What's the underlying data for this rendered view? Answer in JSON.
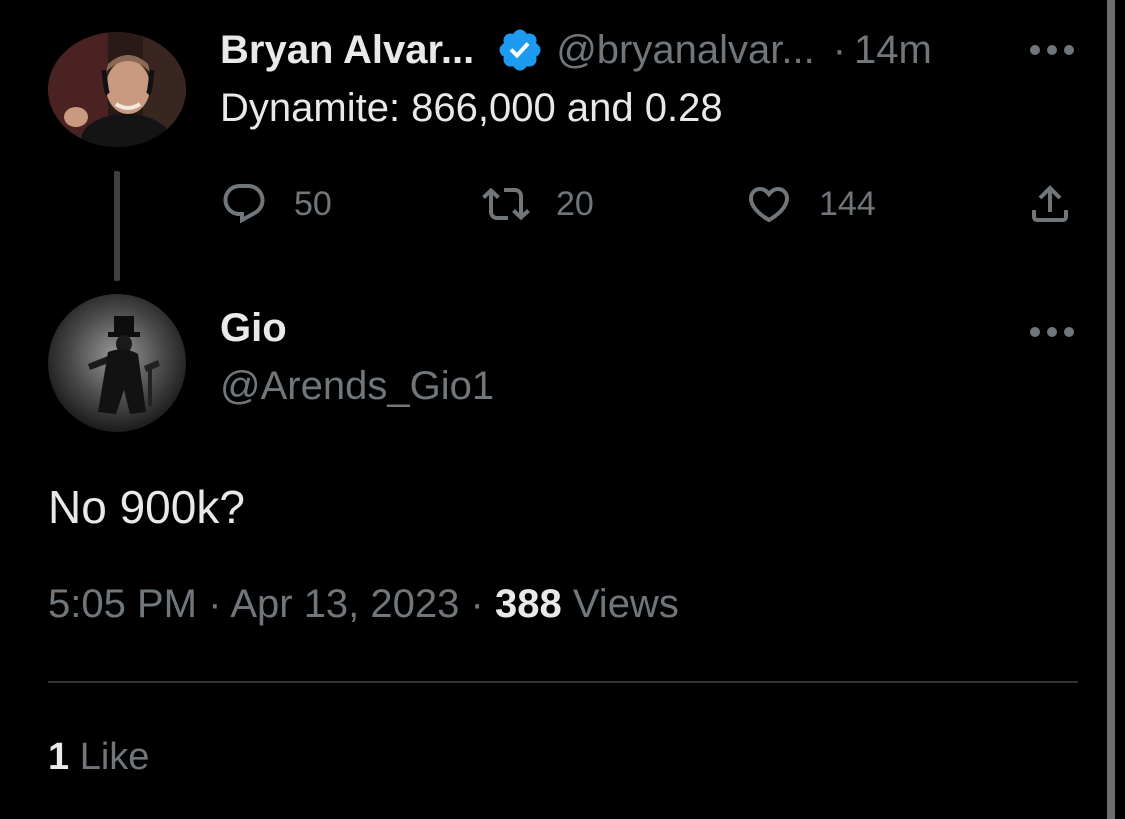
{
  "original_tweet": {
    "display_name": "Bryan Alvar...",
    "handle": "@bryanalvar...",
    "separator": "·",
    "time_ago": "14m",
    "text": "Dynamite: 866,000 and 0.28",
    "reply_count": "50",
    "retweet_count": "20",
    "like_count": "144"
  },
  "reply_tweet": {
    "display_name": "Gio",
    "handle": "@Arends_Gio1",
    "text": "No 900k?",
    "time": "5:05 PM",
    "date": "Apr 13, 2023",
    "separator": "·",
    "views_count": "388",
    "views_label": "Views",
    "likes_count": "1",
    "likes_label": "Like"
  },
  "icons": {
    "verified": "verified-badge-icon",
    "reply": "reply-bubble-icon",
    "retweet": "retweet-icon",
    "like": "heart-icon",
    "share": "share-upload-icon",
    "more": "more-dots-icon"
  },
  "colors": {
    "background": "#000000",
    "text_primary": "#e7e9ea",
    "text_secondary": "#71767b",
    "verified_blue": "#1d9bf0",
    "divider": "#2f3336"
  }
}
